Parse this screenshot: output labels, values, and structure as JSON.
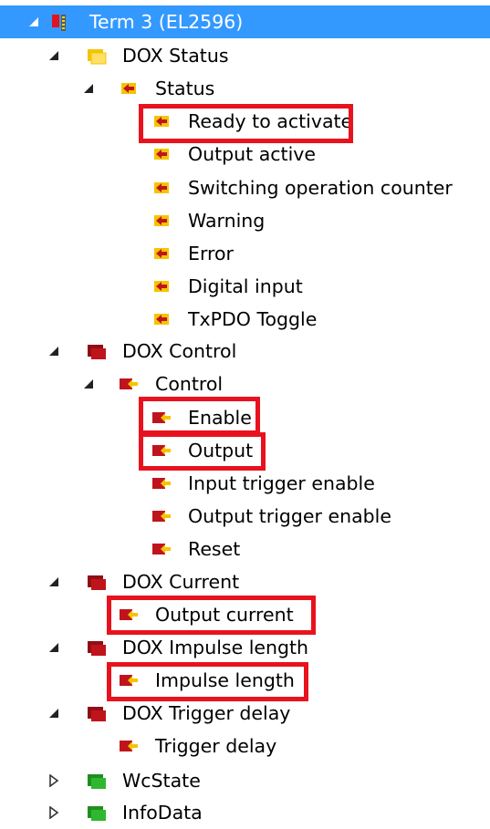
{
  "tree": {
    "root": {
      "label": "Term 3 (EL2596)",
      "icon": "terminal-icon"
    },
    "nodes": [
      {
        "label": "DOX Status",
        "icon": "input-group-icon",
        "expander": "expanded"
      },
      {
        "label": "Status",
        "icon": "input-variable-icon",
        "expander": "expanded"
      },
      {
        "label": "Ready to activate",
        "icon": "input-variable-icon",
        "highlighted": true
      },
      {
        "label": "Output active",
        "icon": "input-variable-icon"
      },
      {
        "label": "Switching operation counter",
        "icon": "input-variable-icon"
      },
      {
        "label": "Warning",
        "icon": "input-variable-icon"
      },
      {
        "label": "Error",
        "icon": "input-variable-icon"
      },
      {
        "label": "Digital input",
        "icon": "input-variable-icon"
      },
      {
        "label": "TxPDO Toggle",
        "icon": "input-variable-icon"
      },
      {
        "label": "DOX Control",
        "icon": "output-group-icon",
        "expander": "expanded"
      },
      {
        "label": "Control",
        "icon": "output-variable-icon",
        "expander": "expanded"
      },
      {
        "label": "Enable",
        "icon": "output-variable-icon",
        "highlighted": true
      },
      {
        "label": "Output",
        "icon": "output-variable-icon",
        "highlighted": true
      },
      {
        "label": "Input trigger enable",
        "icon": "output-variable-icon"
      },
      {
        "label": "Output trigger enable",
        "icon": "output-variable-icon"
      },
      {
        "label": "Reset",
        "icon": "output-variable-icon"
      },
      {
        "label": "DOX Current",
        "icon": "output-group-icon",
        "expander": "expanded"
      },
      {
        "label": "Output current",
        "icon": "output-variable-icon",
        "highlighted": true
      },
      {
        "label": "DOX Impulse length",
        "icon": "output-group-icon",
        "expander": "expanded"
      },
      {
        "label": "Impulse length",
        "icon": "output-variable-icon",
        "highlighted": true
      },
      {
        "label": "DOX Trigger delay",
        "icon": "output-group-icon",
        "expander": "expanded"
      },
      {
        "label": "Trigger delay",
        "icon": "output-variable-icon"
      },
      {
        "label": "WcState",
        "icon": "status-group-icon",
        "expander": "collapsed"
      },
      {
        "label": "InfoData",
        "icon": "status-group-icon",
        "expander": "collapsed"
      }
    ]
  },
  "colors": {
    "selection": "#3399ff",
    "highlight_box": "#e8121e",
    "input_icon": "#f5c400",
    "output_icon": "#c0141c",
    "status_icon": "#2fb82f"
  }
}
